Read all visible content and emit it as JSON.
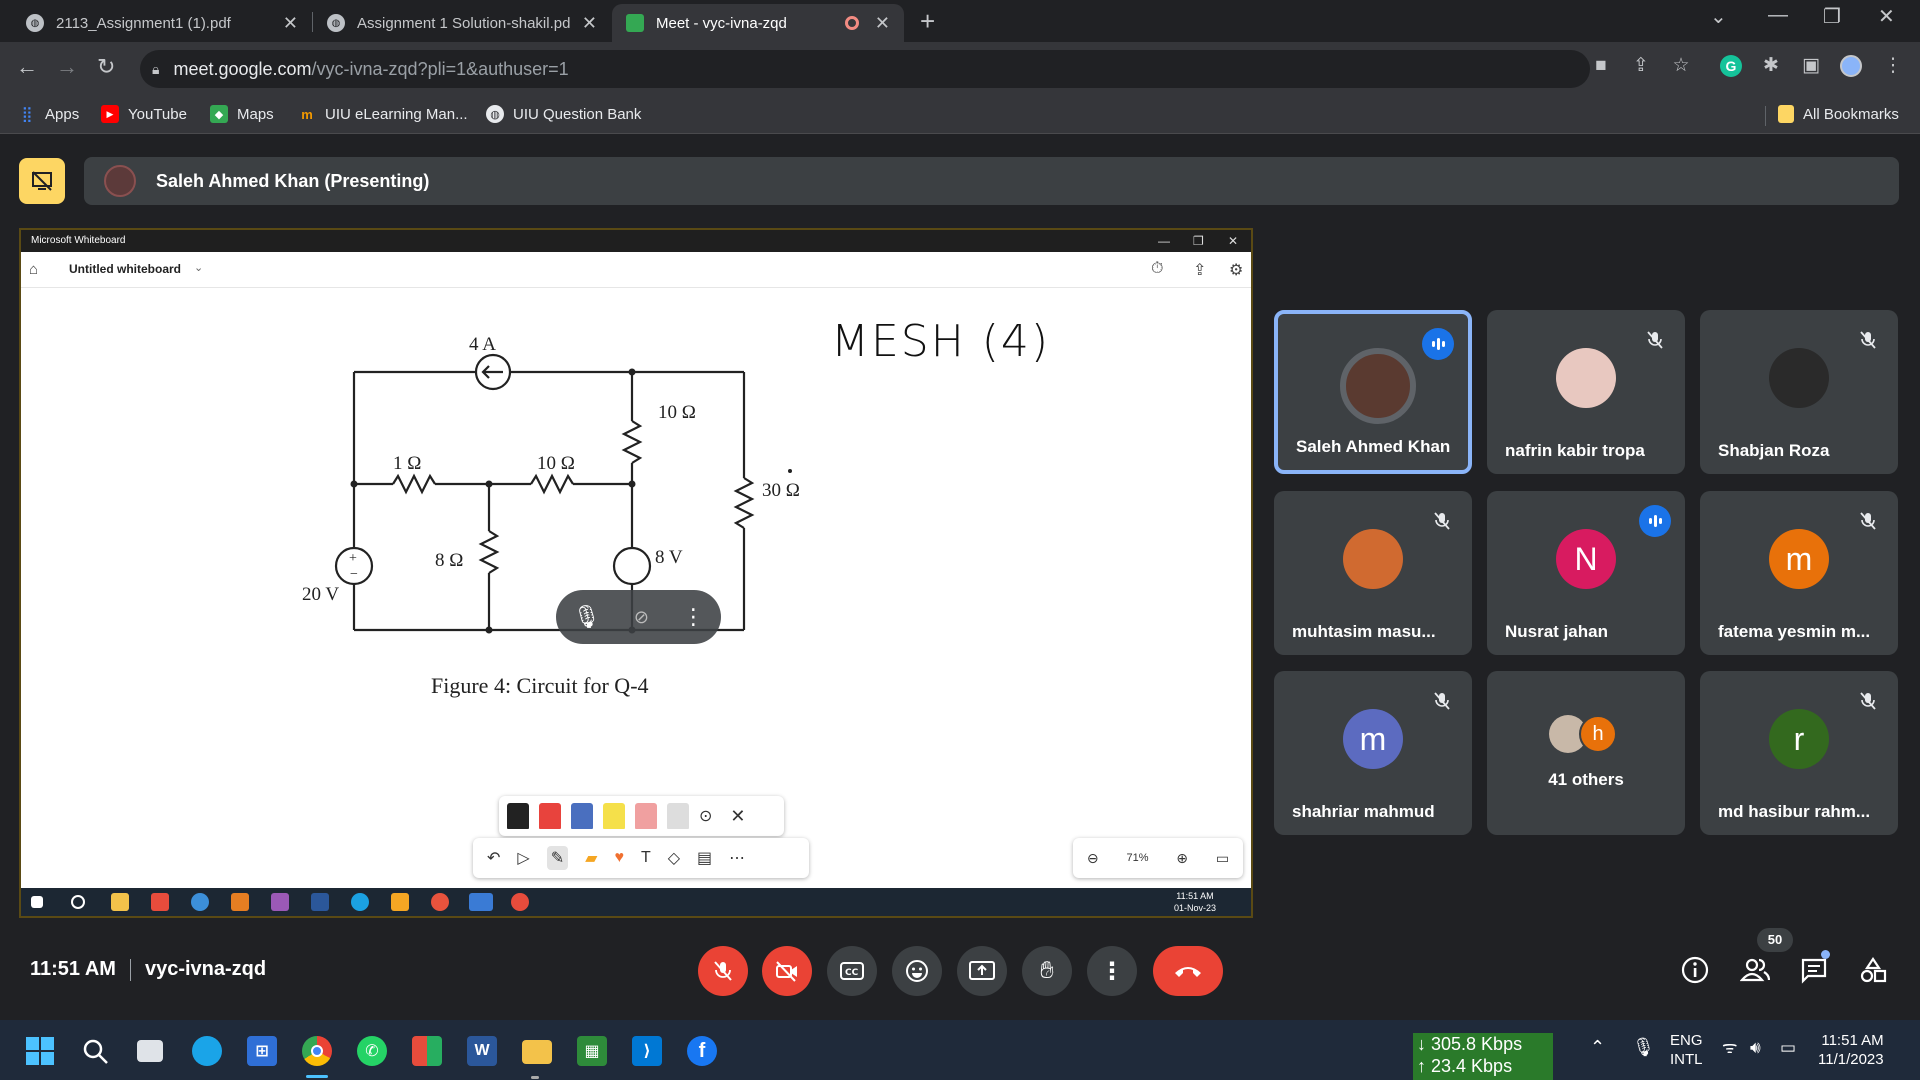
{
  "browser": {
    "tabs": [
      {
        "title": "2113_Assignment1 (1).pdf",
        "close": "✕"
      },
      {
        "title": "Assignment 1 Solution-shakil.pd",
        "close": "✕"
      },
      {
        "title": "Meet - vyc-ivna-zqd",
        "close": "✕"
      }
    ],
    "url_host": "meet.google.com",
    "url_path": "/vyc-ivna-zqd?pli=1&authuser=1",
    "bookmarks": [
      "Apps",
      "YouTube",
      "Maps",
      "UIU eLearning Man...",
      "UIU Question Bank"
    ],
    "all_bookmarks": "All Bookmarks"
  },
  "meet": {
    "presenter_banner": "Saleh Ahmed Khan (Presenting)",
    "time": "11:51 AM",
    "meeting_code": "vyc-ivna-zqd",
    "participant_count": "50",
    "participants": [
      {
        "name": "Saleh Ahmed Khan",
        "state": "speaking"
      },
      {
        "name": "nafrin kabir tropa",
        "state": "muted"
      },
      {
        "name": "Shabjan Roza",
        "state": "muted"
      },
      {
        "name": "muhtasim masu...",
        "state": "muted"
      },
      {
        "name": "Nusrat jahan",
        "initial": "N",
        "state": "speaking"
      },
      {
        "name": "fatema yesmin m...",
        "initial": "m",
        "state": "muted"
      },
      {
        "name": "shahriar mahmud",
        "initial": "m",
        "state": "muted"
      },
      {
        "name": "41 others",
        "initial": "h"
      },
      {
        "name": "md hasibur rahm...",
        "initial": "r",
        "state": "muted"
      }
    ]
  },
  "whiteboard": {
    "app_title": "Microsoft Whiteboard",
    "board_name": "Untitled whiteboard",
    "handwriting": "MESH (4)",
    "caption": "Figure 4:  Circuit for Q-4",
    "zoom": "71%",
    "clock_time": "11:51 AM",
    "clock_date": "01-Nov-23",
    "circuit_labels": {
      "source_current": "4 A",
      "r_top": "10 Ω",
      "r1": "1 Ω",
      "r_mid": "10 Ω",
      "r_right": "30 Ω",
      "r8": "8 Ω",
      "v20": "20 V",
      "v8": "8 V"
    }
  },
  "taskbar": {
    "net_down": "↓ 305.8 Kbps",
    "net_up": "↑ 23.4 Kbps",
    "lang1": "ENG",
    "lang2": "INTL",
    "time": "11:51 AM",
    "date": "11/1/2023"
  }
}
